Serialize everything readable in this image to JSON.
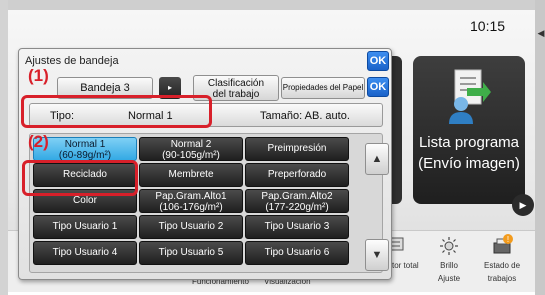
{
  "clock": "10:15",
  "home": {
    "program_tile": {
      "line1": "Lista programa",
      "line2": "(Envío imagen)"
    },
    "bottom_bar": {
      "item1": "Funcionamiento",
      "item2": "Visualización",
      "item3": "tor total",
      "item4_line1": "Brillo",
      "item4_line2": "Ajuste",
      "item5_line1": "Estado de",
      "item5_line2": "trabajos"
    }
  },
  "dialog": {
    "title": "Ajustes de bandeja",
    "ok_label": "OK",
    "tray_button": "Bandeja 3",
    "tray_arrow": "▸",
    "classification": {
      "line1": "Clasificación",
      "line2": "del trabajo"
    },
    "paper_properties": "Propiedades del Papel",
    "type_label": "Tipo:",
    "type_value": "Normal 1",
    "size_label": "Tamaño: AB. auto.",
    "paper_types": [
      {
        "line1": "Normal 1",
        "line2": "(60-89g/m²)"
      },
      {
        "line1": "Normal 2",
        "line2": "(90-105g/m²)"
      },
      {
        "line1": "Preimpresión",
        "line2": ""
      },
      {
        "line1": "Reciclado",
        "line2": ""
      },
      {
        "line1": "Membrete",
        "line2": ""
      },
      {
        "line1": "Preperforado",
        "line2": ""
      },
      {
        "line1": "Color",
        "line2": ""
      },
      {
        "line1": "Pap.Gram.Alto1",
        "line2": "(106-176g/m²)"
      },
      {
        "line1": "Pap.Gram.Alto2",
        "line2": "(177-220g/m²)"
      },
      {
        "line1": "Tipo Usuario 1",
        "line2": ""
      },
      {
        "line1": "Tipo Usuario 2",
        "line2": ""
      },
      {
        "line1": "Tipo Usuario 3",
        "line2": ""
      },
      {
        "line1": "Tipo Usuario 4",
        "line2": ""
      },
      {
        "line1": "Tipo Usuario 5",
        "line2": ""
      },
      {
        "line1": "Tipo Usuario 6",
        "line2": ""
      }
    ],
    "scroll_up": "▲",
    "scroll_down": "▼"
  },
  "callouts": {
    "one": "(1)",
    "two": "(2)"
  },
  "colors": {
    "callout_red": "#d8202a",
    "ok_blue": "#1a62c9",
    "selected_cyan": "#33a9e4"
  }
}
